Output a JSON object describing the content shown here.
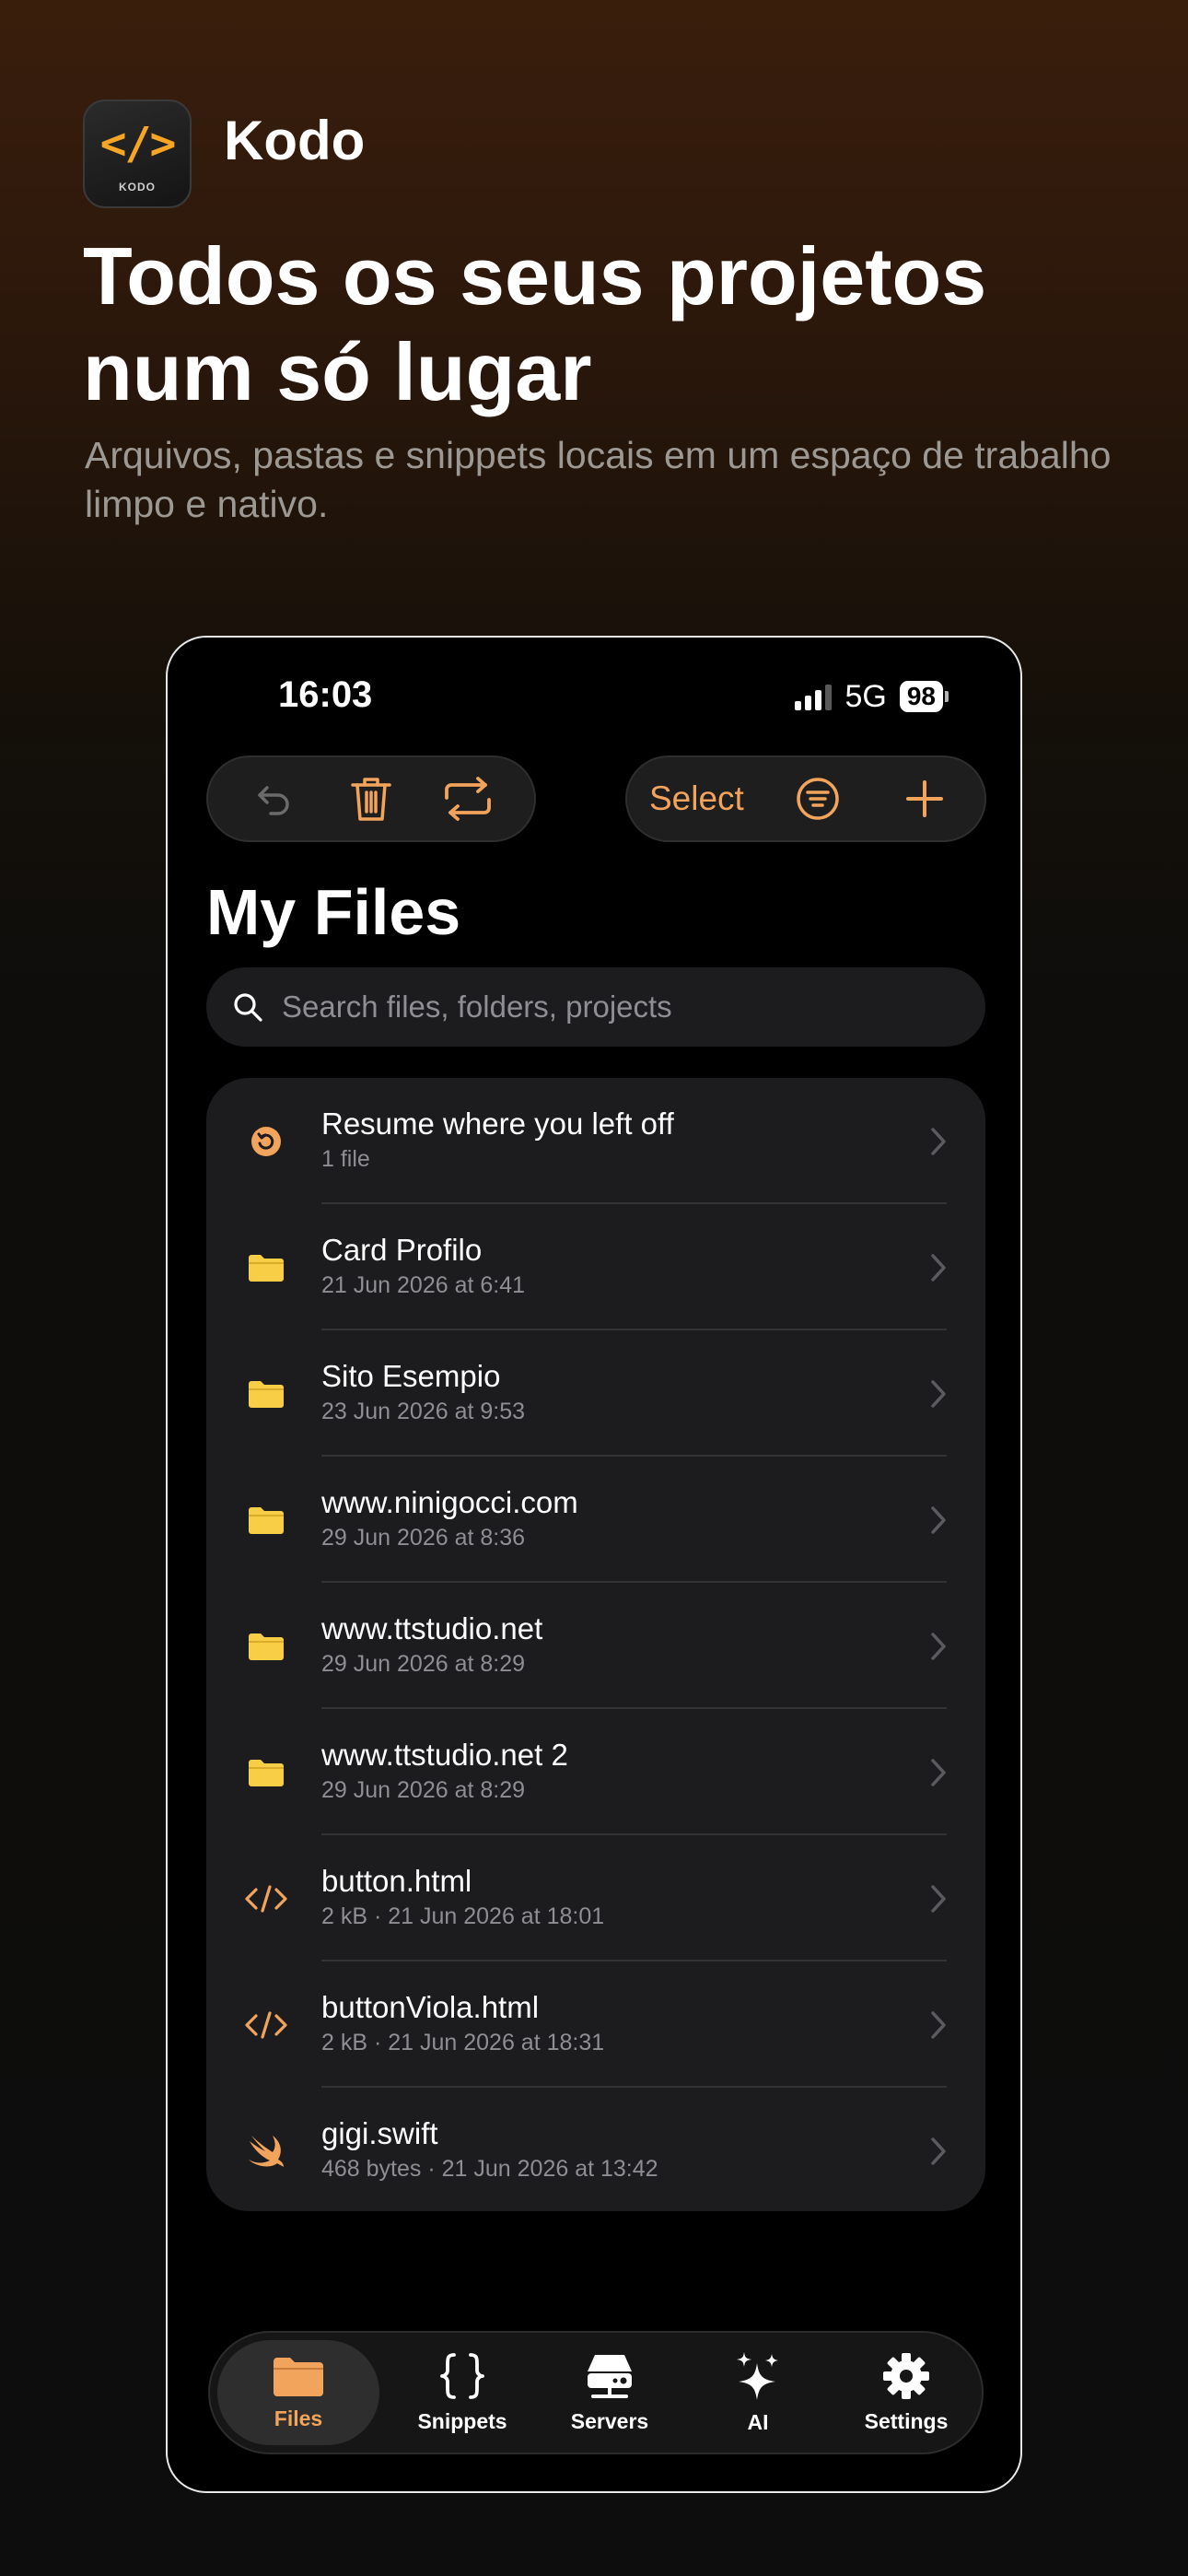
{
  "app": {
    "icon_glyph": "</>",
    "icon_tag": "KODO",
    "name": "Kodo"
  },
  "headline": "Todos os seus projetos num só lugar",
  "subheadline": "Arquivos, pastas e snippets locais em um espaço de trabalho limpo e nativo.",
  "status": {
    "time": "16:03",
    "network": "5G",
    "battery": "98"
  },
  "toolbar": {
    "select_label": "Select"
  },
  "page": {
    "title": "My Files"
  },
  "search": {
    "placeholder": "Search files, folders, projects"
  },
  "files": [
    {
      "icon": "resume-icon",
      "name": "Resume where you left off",
      "meta": "1 file"
    },
    {
      "icon": "folder-icon",
      "name": "Card Profilo",
      "meta": "21 Jun 2026 at 6:41"
    },
    {
      "icon": "folder-icon",
      "name": "Sito Esempio",
      "meta": "23 Jun 2026 at 9:53"
    },
    {
      "icon": "folder-icon",
      "name": "www.ninigocci.com",
      "meta": "29 Jun 2026 at 8:36"
    },
    {
      "icon": "folder-icon",
      "name": "www.ttstudio.net",
      "meta": "29 Jun 2026 at 8:29"
    },
    {
      "icon": "folder-icon",
      "name": "www.ttstudio.net 2",
      "meta": "29 Jun 2026 at 8:29"
    },
    {
      "icon": "code-icon",
      "name": "button.html",
      "meta": "2 kB · 21 Jun 2026 at 18:01"
    },
    {
      "icon": "code-icon",
      "name": "buttonViola.html",
      "meta": "2 kB · 21 Jun 2026 at 18:31"
    },
    {
      "icon": "swift-icon",
      "name": "gigi.swift",
      "meta": "468 bytes · 21 Jun 2026 at 13:42"
    }
  ],
  "tabs": [
    {
      "label": "Files",
      "active": true
    },
    {
      "label": "Snippets",
      "active": false
    },
    {
      "label": "Servers",
      "active": false
    },
    {
      "label": "AI",
      "active": false
    },
    {
      "label": "Settings",
      "active": false
    }
  ],
  "colors": {
    "accent": "#f2a35c",
    "folder": "#f7ce46",
    "brand": "#f6a524"
  }
}
